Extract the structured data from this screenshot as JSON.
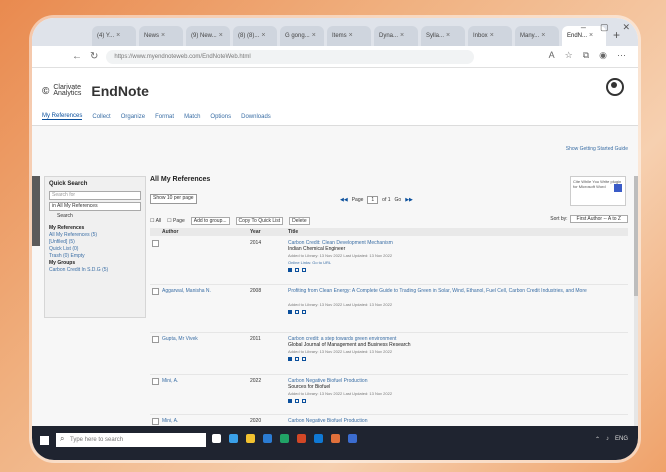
{
  "browser": {
    "tabs": [
      {
        "label": "(4) Y..."
      },
      {
        "label": "News"
      },
      {
        "label": "(9) New..."
      },
      {
        "label": "(8) (8)..."
      },
      {
        "label": "G gong..."
      },
      {
        "label": "Items"
      },
      {
        "label": "Dyna..."
      },
      {
        "label": "Sylla..."
      },
      {
        "label": "Inbox"
      },
      {
        "label": "Many..."
      },
      {
        "label": "EndN..."
      }
    ],
    "url": "https://www.myendnoteweb.com/EndNoteWeb.html"
  },
  "app": {
    "brand_line1": "Clarivate",
    "brand_line2": "Analytics",
    "name": "EndNote"
  },
  "subnav": [
    "My References",
    "Collect",
    "Organize",
    "Format",
    "Match",
    "Options",
    "Downloads"
  ],
  "show_getting_started": "Show Getting Started Guide",
  "quick_search": {
    "title": "Quick Search",
    "placeholder": "Search for",
    "in_label": "in All My References",
    "button": "Search",
    "my_refs_title": "My References",
    "items": [
      "All My References (5)",
      "[Unfiled] (5)",
      "Quick List (0)",
      "Trash (0) Empty",
      "My Groups",
      "Carbon Credit In S.D.G (5)"
    ]
  },
  "main": {
    "title": "All My References",
    "show_per_page": "Show 10 per page",
    "page_label": "Page",
    "page_value": "1",
    "page_of": "of 1",
    "page_go": "Go",
    "promo_text": "Cite While You Write plugin for Microsoft Word",
    "toolbar": {
      "all": "All",
      "page": "Page",
      "add_to_group": "Add to group...",
      "copy_to_quick_list": "Copy To Quick List",
      "delete": "Delete"
    },
    "sort_label": "Sort by:",
    "sort_value": "First Author -- A to Z",
    "columns": {
      "author": "Author",
      "year": "Year",
      "title": "Title"
    }
  },
  "references": [
    {
      "author": "",
      "year": "2014",
      "title": "Carbon Credit: Clean Development Mechanism",
      "journal": "Indian Chemical Engineer",
      "meta": "Added to Library: 13 Nov 2022   Last Updated: 13 Nov 2022",
      "extra": "Online Links: Go to URL"
    },
    {
      "author": "Aggarwal, Manisha N.",
      "year": "2008",
      "title": "Profiting from Clean Energy: A Complete Guide to Trading Green in Solar, Wind, Ethanol, Fuel Cell, Carbon Credit Industries, and More",
      "journal": "",
      "meta": "Added to Library: 13 Nov 2022   Last Updated: 13 Nov 2022",
      "extra": ""
    },
    {
      "author": "Gupta, Mr Vivek",
      "year": "2011",
      "title": "Carbon credit: a step towards green environment",
      "journal": "Global Journal of Management and Business Research",
      "meta": "Added to Library: 13 Nov 2022   Last Updated: 13 Nov 2022",
      "extra": ""
    },
    {
      "author": "Mini, A.",
      "year": "2022",
      "title": "Carbon Negative Biofuel Production",
      "journal": "Sources for Biofuel",
      "meta": "Added to Library: 13 Nov 2022   Last Updated: 13 Nov 2022",
      "extra": ""
    },
    {
      "author": "Mini, A.",
      "year": "2020",
      "title": "Carbon Negative Biofuel Production",
      "journal": "",
      "meta": "",
      "extra": ""
    }
  ],
  "taskbar": {
    "search_placeholder": "Type here to search"
  }
}
